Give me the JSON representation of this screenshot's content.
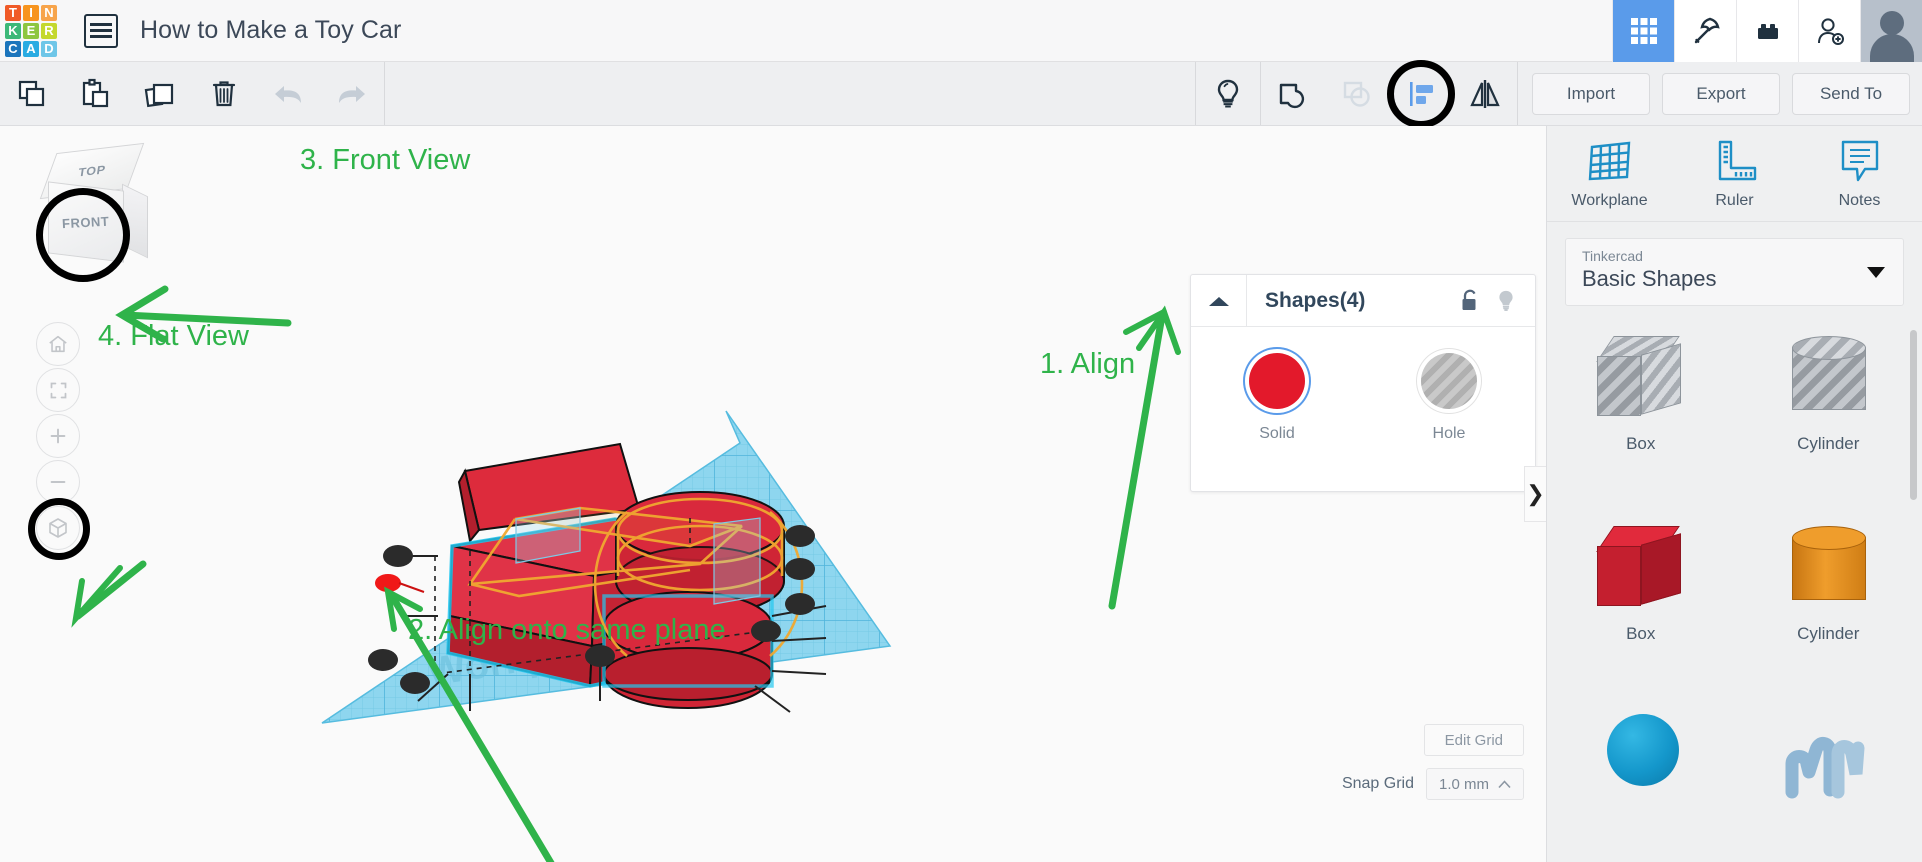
{
  "app": {
    "logo_tiles": [
      {
        "char": "T",
        "color": "#f05a28"
      },
      {
        "char": "I",
        "color": "#f7941e"
      },
      {
        "char": "N",
        "color": "#f7a44b"
      },
      {
        "char": "K",
        "color": "#3cb878"
      },
      {
        "char": "E",
        "color": "#8dc63f"
      },
      {
        "char": "R",
        "color": "#c4d82e"
      },
      {
        "char": "C",
        "color": "#1c75bc"
      },
      {
        "char": "A",
        "color": "#29abe2"
      },
      {
        "char": "D",
        "color": "#6ec6e8"
      }
    ],
    "menu_icon": "hamburger-menu-icon",
    "title": "How to Make a Toy Car"
  },
  "topbar_icons": [
    {
      "name": "grid-gallery-icon",
      "label": "Gallery",
      "active": true
    },
    {
      "name": "pickaxe-icon",
      "label": "Blocks",
      "active": false
    },
    {
      "name": "lego-brick-icon",
      "label": "Bricks",
      "active": false
    },
    {
      "name": "add-person-icon",
      "label": "Invite",
      "active": false
    }
  ],
  "avatar": {
    "name": "user-avatar",
    "label": "Account"
  },
  "toolbar": {
    "left_tools": [
      {
        "name": "copy-icon",
        "label": "Copy"
      },
      {
        "name": "paste-icon",
        "label": "Paste"
      },
      {
        "name": "duplicate-icon",
        "label": "Duplicate"
      },
      {
        "name": "delete-icon",
        "label": "Delete"
      }
    ],
    "history_tools": [
      {
        "name": "undo-icon",
        "label": "Undo"
      },
      {
        "name": "redo-icon",
        "label": "Redo"
      }
    ],
    "right_tools": [
      {
        "name": "lightbulb-icon",
        "label": "Hint",
        "state": "enabled"
      },
      {
        "name": "group-icon",
        "label": "Group",
        "state": "enabled"
      },
      {
        "name": "ungroup-icon",
        "label": "Ungroup",
        "state": "disabled"
      },
      {
        "name": "align-icon",
        "label": "Align",
        "state": "highlighted"
      },
      {
        "name": "mirror-icon",
        "label": "Mirror",
        "state": "enabled"
      }
    ],
    "actions": [
      {
        "name": "import-button",
        "label": "Import"
      },
      {
        "name": "export-button",
        "label": "Export"
      },
      {
        "name": "send-to-button",
        "label": "Send To"
      }
    ]
  },
  "canvas": {
    "viewcube": {
      "top_label": "TOP",
      "front_label": "FRONT",
      "highlighted": true
    },
    "view_buttons": [
      {
        "name": "home-view-button",
        "icon": "home-icon",
        "highlighted": false
      },
      {
        "name": "fit-view-button",
        "icon": "fit-frame-icon",
        "highlighted": false
      },
      {
        "name": "zoom-in-button",
        "icon": "plus-icon",
        "highlighted": false
      },
      {
        "name": "zoom-out-button",
        "icon": "minus-icon",
        "highlighted": false
      },
      {
        "name": "flat-view-button",
        "icon": "cube-icon",
        "highlighted": true
      }
    ],
    "workplane_watermark": "Workplane",
    "annotations": [
      {
        "name": "annotation-front-view",
        "text": "3. Front View"
      },
      {
        "name": "annotation-flat-view",
        "text": "4. Flat View"
      },
      {
        "name": "annotation-align-onto-same-plane",
        "text": "2. Align onto same plane"
      },
      {
        "name": "annotation-align",
        "text": "1. Align"
      }
    ],
    "annotation_color": "#2fb34a",
    "grid_controls": {
      "edit_grid_label": "Edit Grid",
      "snap_grid_label": "Snap Grid",
      "snap_grid_value": "1.0 mm"
    },
    "panel_toggle": "❯"
  },
  "shapes_panel": {
    "collapse_icon": "triangle-up-icon",
    "title": "Shapes(4)",
    "lock_icon": "unlock-icon",
    "bulb_icon": "lightbulb-icon",
    "swatches": [
      {
        "name": "solid-swatch",
        "label": "Solid",
        "color": "#e3192b",
        "selected": true
      },
      {
        "name": "hole-swatch",
        "label": "Hole",
        "color": "#b0b0b0",
        "selected": false
      }
    ]
  },
  "sidebar": {
    "tools": [
      {
        "name": "workplane-tool",
        "icon": "workplane-icon",
        "label": "Workplane"
      },
      {
        "name": "ruler-tool",
        "icon": "ruler-icon",
        "label": "Ruler"
      },
      {
        "name": "notes-tool",
        "icon": "notes-icon",
        "label": "Notes"
      }
    ],
    "library": {
      "owner": "Tinkercad",
      "collection": "Basic Shapes"
    },
    "shapes": [
      {
        "name": "shape-box-hole",
        "label": "Box",
        "kind": "cube",
        "style": "hole"
      },
      {
        "name": "shape-cylinder-hole",
        "label": "Cylinder",
        "kind": "cylinder",
        "style": "hole"
      },
      {
        "name": "shape-box-red",
        "label": "Box",
        "kind": "cube",
        "color": "#cf2233"
      },
      {
        "name": "shape-cylinder-orange",
        "label": "Cylinder",
        "kind": "cylinder",
        "color": "#e8921f"
      },
      {
        "name": "shape-sphere-blue",
        "label": "",
        "kind": "sphere",
        "color": "#1497cb"
      },
      {
        "name": "shape-scribble",
        "label": "",
        "kind": "scribble",
        "color": "#8fb6d4"
      }
    ]
  }
}
